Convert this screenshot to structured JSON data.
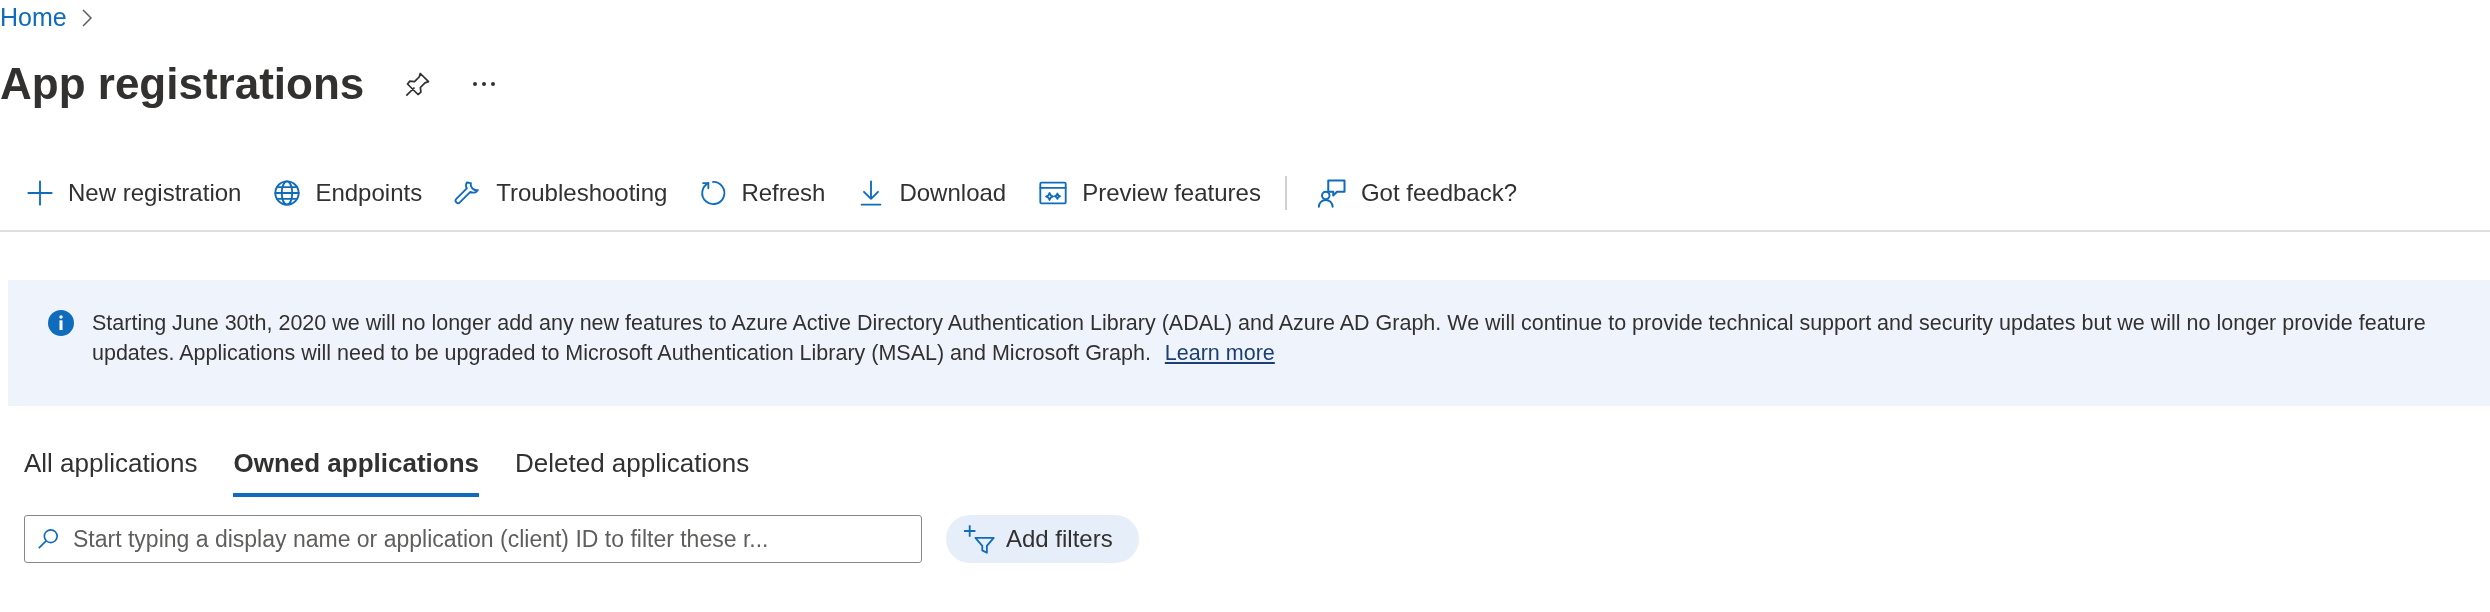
{
  "breadcrumb": [
    {
      "label": "Home"
    }
  ],
  "page_title": "App registrations",
  "toolbar": [
    {
      "label": "New registration"
    },
    {
      "label": "Endpoints"
    },
    {
      "label": "Troubleshooting"
    },
    {
      "label": "Refresh"
    },
    {
      "label": "Download"
    },
    {
      "label": "Preview features"
    },
    {
      "label": "Got feedback?"
    }
  ],
  "banner": {
    "text": "Starting June 30th, 2020 we will no longer add any new features to Azure Active Directory Authentication Library (ADAL) and Azure AD Graph. We will continue to provide technical support and security updates but we will no longer provide feature updates. Applications will need to be upgraded to Microsoft Authentication Library (MSAL) and Microsoft Graph.",
    "link": "Learn more"
  },
  "tabs": [
    {
      "label": "All applications",
      "selected": false
    },
    {
      "label": "Owned applications",
      "selected": true
    },
    {
      "label": "Deleted applications",
      "selected": false
    }
  ],
  "search": {
    "placeholder": "Start typing a display name or application (client) ID to filter these r..."
  },
  "filter_button": {
    "label": "Add filters"
  }
}
